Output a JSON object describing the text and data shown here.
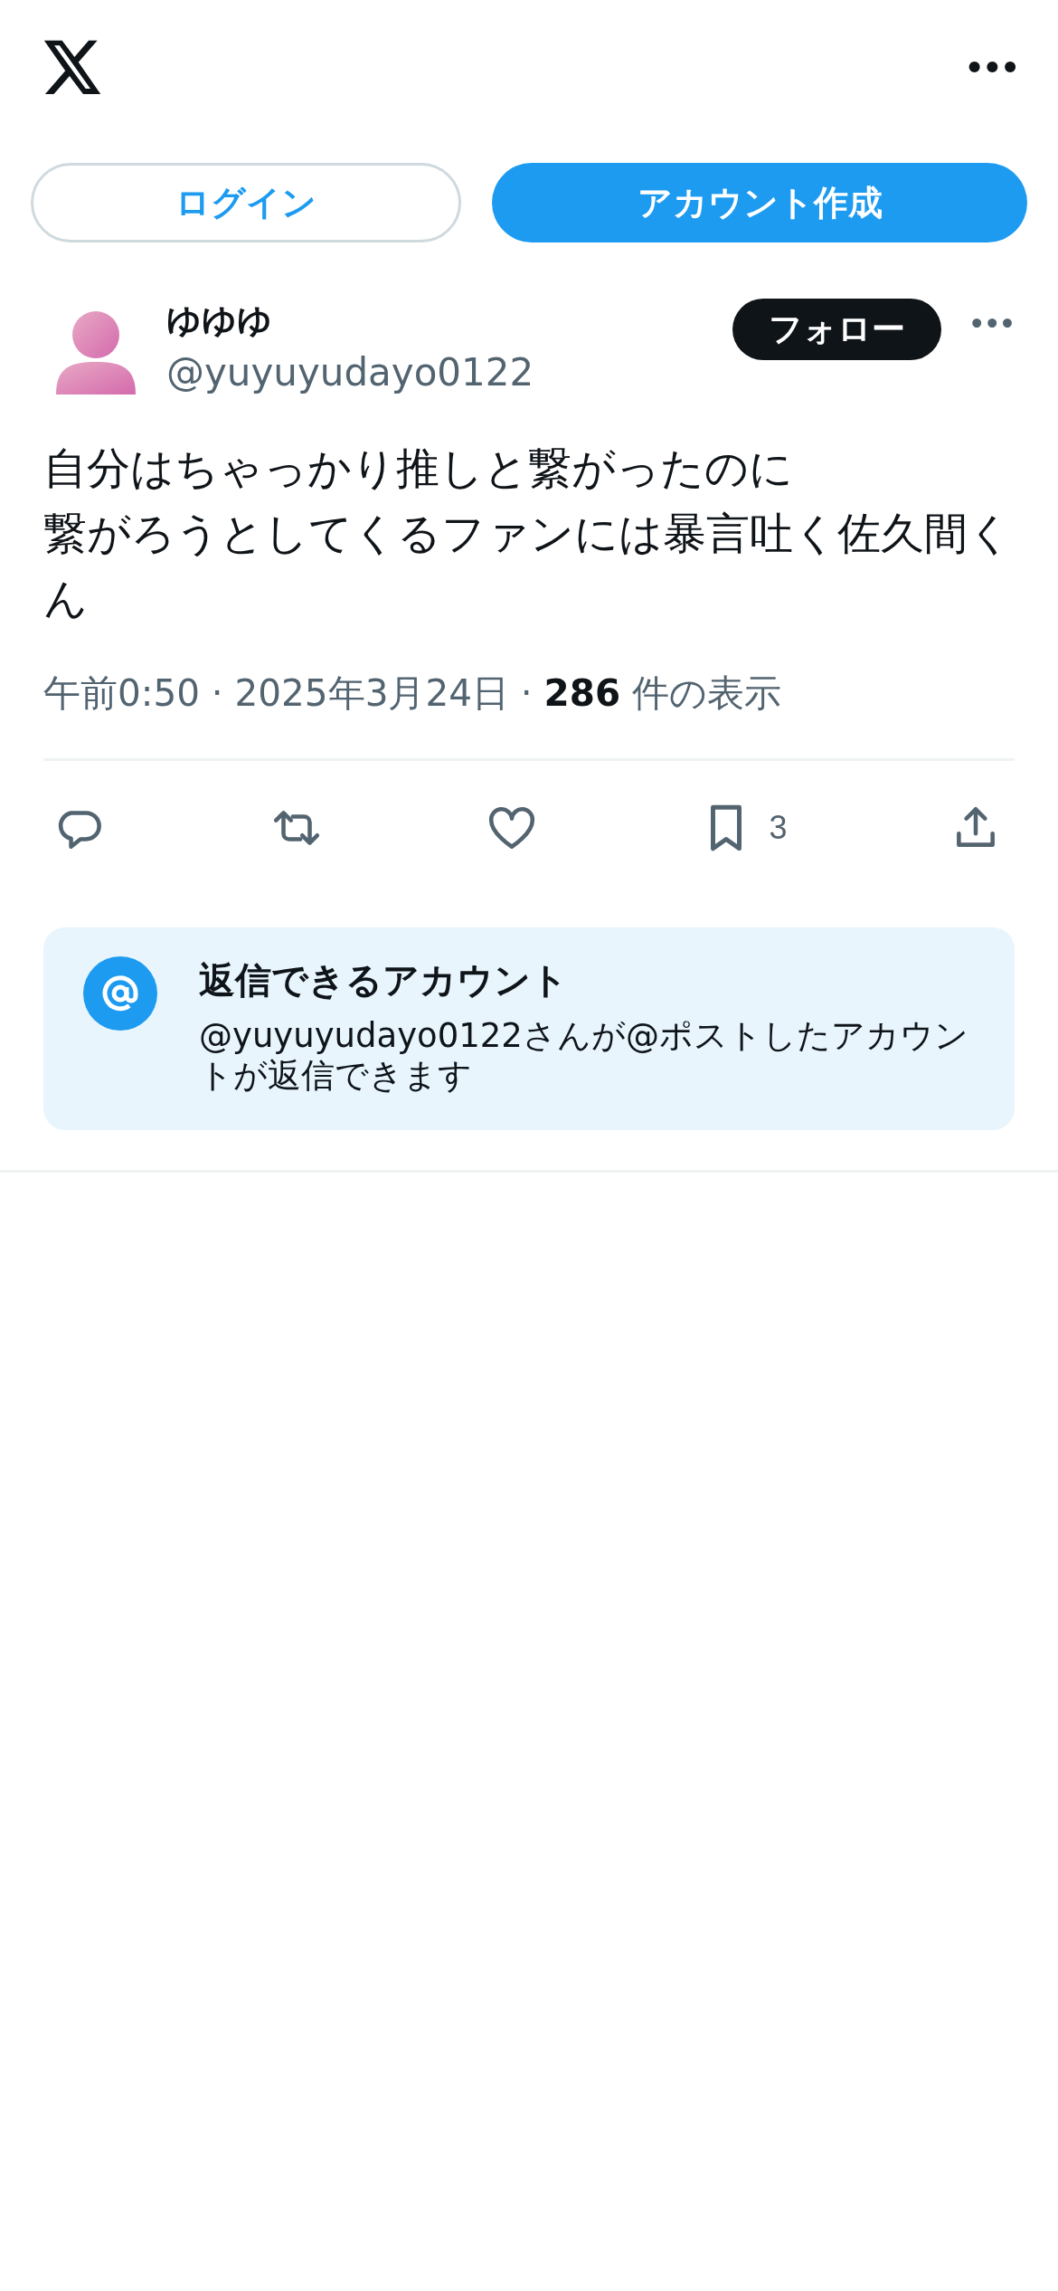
{
  "header": {
    "menu": "•••"
  },
  "auth_buttons": [
    {
      "label": "ログイン",
      "kind": "outline"
    },
    {
      "label": "アカウント作成",
      "kind": "filled"
    }
  ],
  "post": {
    "author": {
      "name": "ゆゆゆ",
      "handle": "@yuyuyudayo0122"
    },
    "follow_button": "フォロー",
    "more": "•••",
    "text_lines": [
      "自分はちゃっかり推しと繋がったのに",
      "繋がろうとしてくるファンには暴言吐く佐久間くん"
    ],
    "meta": "午前0:50 · 2025年3月24日 · **286** 件の表示",
    "actions": [
      {
        "kind": "reply"
      },
      {
        "kind": "repost"
      },
      {
        "kind": "like"
      },
      {
        "kind": "bookmark",
        "count": "3"
      },
      {
        "kind": "share"
      }
    ],
    "reply_notice": {
      "title": "返信できるアカウント",
      "body": "@yuyuyudayo0122さんが@ポストしたアカウントが返信できます"
    }
  }
}
